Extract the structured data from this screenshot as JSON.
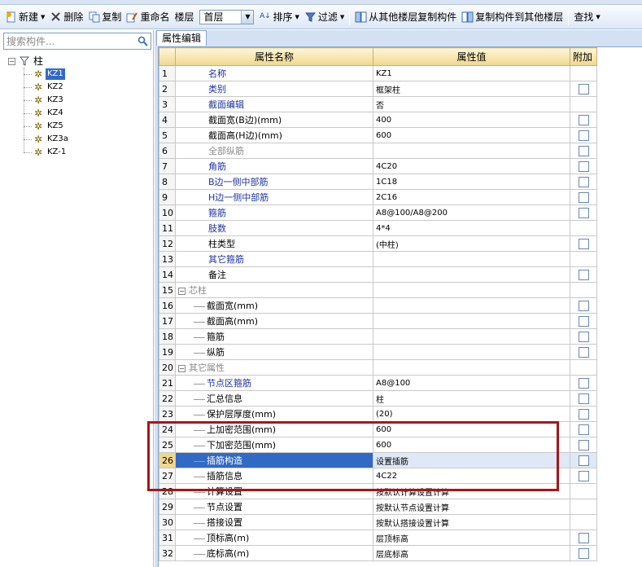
{
  "toolbar": {
    "new_label": "新建",
    "delete_label": "删除",
    "copy_label": "复制",
    "rename_label": "重命名",
    "floor_label": "楼层",
    "floor_value": "首层",
    "sort_label": "排序",
    "filter_label": "过滤",
    "copy_from_label": "从其他楼层复制构件",
    "copy_to_label": "复制构件到其他楼层",
    "find_label": "查找"
  },
  "left_panel": {
    "search_placeholder": "搜索构件...",
    "root_label": "柱",
    "items": [
      {
        "label": "KZ1",
        "selected": true
      },
      {
        "label": "KZ2",
        "selected": false
      },
      {
        "label": "KZ3",
        "selected": false
      },
      {
        "label": "KZ4",
        "selected": false
      },
      {
        "label": "KZ5",
        "selected": false
      },
      {
        "label": "KZ3a",
        "selected": false
      },
      {
        "label": "KZ-1",
        "selected": false
      }
    ]
  },
  "properties": {
    "tab_label": "属性编辑",
    "col_name": "属性名称",
    "col_value": "属性值",
    "col_extra": "附加",
    "rows": [
      {
        "n": "1",
        "name": "名称",
        "value": "KZ1",
        "checkbox": false,
        "style": "blue",
        "indent": 0
      },
      {
        "n": "2",
        "name": "类别",
        "value": "框架柱",
        "checkbox": true,
        "style": "blue",
        "indent": 0
      },
      {
        "n": "3",
        "name": "截面编辑",
        "value": "否",
        "checkbox": false,
        "style": "blue",
        "indent": 0
      },
      {
        "n": "4",
        "name": "截面宽(B边)(mm)",
        "value": "400",
        "checkbox": true,
        "style": "black",
        "indent": 0
      },
      {
        "n": "5",
        "name": "截面高(H边)(mm)",
        "value": "600",
        "checkbox": true,
        "style": "black",
        "indent": 0
      },
      {
        "n": "6",
        "name": "全部纵筋",
        "value": "",
        "checkbox": true,
        "style": "gray",
        "indent": 0
      },
      {
        "n": "7",
        "name": "角筋",
        "value": "4C20",
        "checkbox": true,
        "style": "blue",
        "indent": 0
      },
      {
        "n": "8",
        "name": "B边一侧中部筋",
        "value": "1C18",
        "checkbox": true,
        "style": "blue",
        "indent": 0
      },
      {
        "n": "9",
        "name": "H边一侧中部筋",
        "value": "2C16",
        "checkbox": true,
        "style": "blue",
        "indent": 0
      },
      {
        "n": "10",
        "name": "箍筋",
        "value": "A8@100/A8@200",
        "checkbox": true,
        "style": "blue",
        "indent": 0
      },
      {
        "n": "11",
        "name": "肢数",
        "value": "4*4",
        "checkbox": false,
        "style": "blue",
        "indent": 0
      },
      {
        "n": "12",
        "name": "柱类型",
        "value": "(中柱)",
        "checkbox": true,
        "style": "black",
        "indent": 0
      },
      {
        "n": "13",
        "name": "其它箍筋",
        "value": "",
        "checkbox": false,
        "style": "blue",
        "indent": 0
      },
      {
        "n": "14",
        "name": "备注",
        "value": "",
        "checkbox": true,
        "style": "black",
        "indent": 0
      },
      {
        "n": "15",
        "name": "芯柱",
        "value": "",
        "checkbox": false,
        "style": "gray",
        "indent": -1
      },
      {
        "n": "16",
        "name": "截面宽(mm)",
        "value": "",
        "checkbox": true,
        "style": "black",
        "indent": 1
      },
      {
        "n": "17",
        "name": "截面高(mm)",
        "value": "",
        "checkbox": true,
        "style": "black",
        "indent": 1
      },
      {
        "n": "18",
        "name": "箍筋",
        "value": "",
        "checkbox": true,
        "style": "black",
        "indent": 1
      },
      {
        "n": "19",
        "name": "纵筋",
        "value": "",
        "checkbox": true,
        "style": "black",
        "indent": 1
      },
      {
        "n": "20",
        "name": "其它属性",
        "value": "",
        "checkbox": false,
        "style": "gray",
        "indent": -1
      },
      {
        "n": "21",
        "name": "节点区箍筋",
        "value": "A8@100",
        "checkbox": true,
        "style": "blue",
        "indent": 1
      },
      {
        "n": "22",
        "name": "汇总信息",
        "value": "柱",
        "checkbox": true,
        "style": "black",
        "indent": 1
      },
      {
        "n": "23",
        "name": "保护层厚度(mm)",
        "value": "(20)",
        "checkbox": true,
        "style": "black",
        "indent": 1
      },
      {
        "n": "24",
        "name": "上加密范围(mm)",
        "value": "600",
        "checkbox": true,
        "style": "black",
        "indent": 1
      },
      {
        "n": "25",
        "name": "下加密范围(mm)",
        "value": "600",
        "checkbox": true,
        "style": "black",
        "indent": 1
      },
      {
        "n": "26",
        "name": "插筋构造",
        "value": "设置插筋",
        "checkbox": true,
        "style": "black",
        "indent": 1,
        "selected": true
      },
      {
        "n": "27",
        "name": "插筋信息",
        "value": "4C22",
        "checkbox": true,
        "style": "black",
        "indent": 1
      },
      {
        "n": "28",
        "name": "计算设置",
        "value": "按默认计算设置计算",
        "checkbox": false,
        "style": "black",
        "indent": 1
      },
      {
        "n": "29",
        "name": "节点设置",
        "value": "按默认节点设置计算",
        "checkbox": false,
        "style": "black",
        "indent": 1
      },
      {
        "n": "30",
        "name": "搭接设置",
        "value": "按默认搭接设置计算",
        "checkbox": false,
        "style": "black",
        "indent": 1
      },
      {
        "n": "31",
        "name": "顶标高(m)",
        "value": "层顶标高",
        "checkbox": true,
        "style": "black",
        "indent": 1
      },
      {
        "n": "32",
        "name": "底标高(m)",
        "value": "层底标高",
        "checkbox": true,
        "style": "black",
        "indent": 1
      }
    ]
  },
  "colors": {
    "highlight_box": "#a8151a",
    "selection": "#316ac5",
    "link_text": "#1c32a6"
  }
}
